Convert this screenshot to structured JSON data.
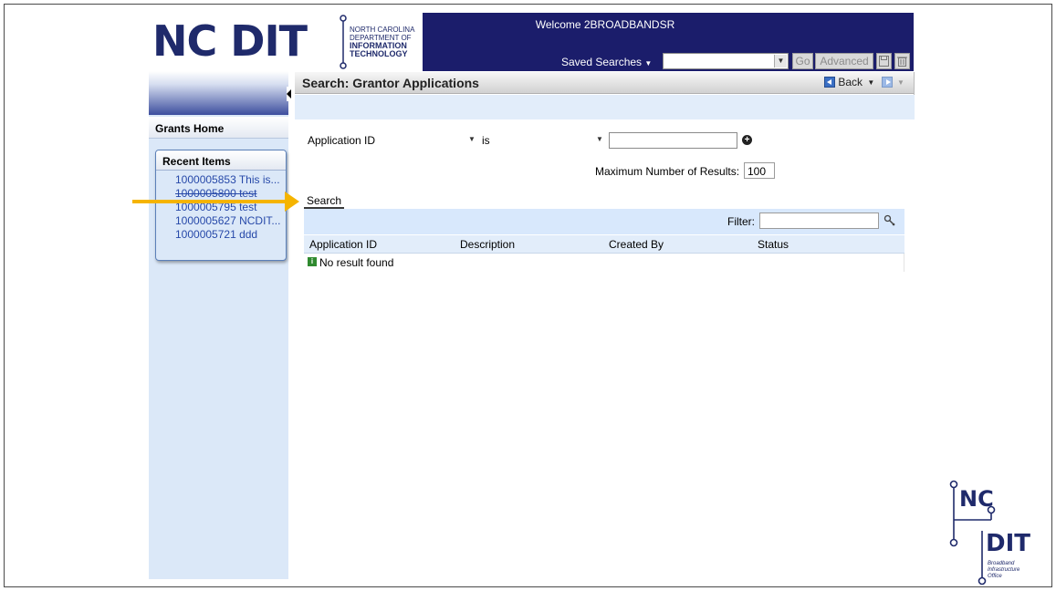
{
  "header": {
    "logo_main": "NC DIT",
    "logo_line1": "NORTH CAROLINA",
    "logo_line2": "DEPARTMENT OF",
    "logo_line3": "INFORMATION",
    "logo_line4": "TECHNOLOGY",
    "welcome": "Welcome 2BROADBANDSR",
    "saved_searches_label": "Saved Searches",
    "saved_searches_value": "",
    "go_label": "Go",
    "advanced_label": "Advanced",
    "brand_color": "#1b1d6b"
  },
  "sidebar": {
    "grants_home": "Grants Home",
    "recent_title": "Recent Items",
    "recent_items": [
      {
        "label": "1000005853 This is..."
      },
      {
        "label": "1000005800 test"
      },
      {
        "label": "1000005795 test"
      },
      {
        "label": "1000005627 NCDIT..."
      },
      {
        "label": "1000005721 ddd"
      }
    ]
  },
  "main": {
    "title": "Search: Grantor Applications",
    "back_label": "Back",
    "criteria": {
      "field": "Application ID",
      "operator": "is",
      "value": ""
    },
    "max_results_label": "Maximum Number of Results:",
    "max_results_value": "100",
    "search_tab_label": "Search",
    "filter_label": "Filter:",
    "filter_value": "",
    "columns": [
      "Application ID",
      "Description",
      "Created By",
      "Status"
    ],
    "empty_message": "No result found",
    "arrow_color": "#f5b400"
  },
  "footer_logo": {
    "nc": "NC",
    "dit": "DIT",
    "line1": "Broadband",
    "line2": "Infrastructure",
    "line3": "Office"
  }
}
